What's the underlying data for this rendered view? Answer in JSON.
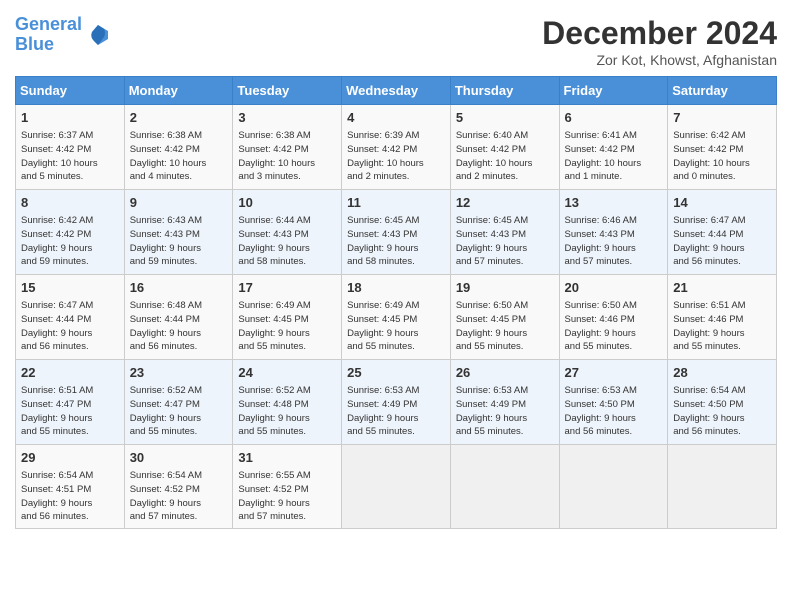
{
  "header": {
    "logo_line1": "General",
    "logo_line2": "Blue",
    "month": "December 2024",
    "location": "Zor Kot, Khowst, Afghanistan"
  },
  "days_of_week": [
    "Sunday",
    "Monday",
    "Tuesday",
    "Wednesday",
    "Thursday",
    "Friday",
    "Saturday"
  ],
  "weeks": [
    [
      {
        "day": "1",
        "sunrise": "6:37 AM",
        "sunset": "4:42 PM",
        "daylight": "10 hours and 5 minutes."
      },
      {
        "day": "2",
        "sunrise": "6:38 AM",
        "sunset": "4:42 PM",
        "daylight": "10 hours and 4 minutes."
      },
      {
        "day": "3",
        "sunrise": "6:38 AM",
        "sunset": "4:42 PM",
        "daylight": "10 hours and 3 minutes."
      },
      {
        "day": "4",
        "sunrise": "6:39 AM",
        "sunset": "4:42 PM",
        "daylight": "10 hours and 2 minutes."
      },
      {
        "day": "5",
        "sunrise": "6:40 AM",
        "sunset": "4:42 PM",
        "daylight": "10 hours and 2 minutes."
      },
      {
        "day": "6",
        "sunrise": "6:41 AM",
        "sunset": "4:42 PM",
        "daylight": "10 hours and 1 minute."
      },
      {
        "day": "7",
        "sunrise": "6:42 AM",
        "sunset": "4:42 PM",
        "daylight": "10 hours and 0 minutes."
      }
    ],
    [
      {
        "day": "8",
        "sunrise": "6:42 AM",
        "sunset": "4:42 PM",
        "daylight": "9 hours and 59 minutes."
      },
      {
        "day": "9",
        "sunrise": "6:43 AM",
        "sunset": "4:43 PM",
        "daylight": "9 hours and 59 minutes."
      },
      {
        "day": "10",
        "sunrise": "6:44 AM",
        "sunset": "4:43 PM",
        "daylight": "9 hours and 58 minutes."
      },
      {
        "day": "11",
        "sunrise": "6:45 AM",
        "sunset": "4:43 PM",
        "daylight": "9 hours and 58 minutes."
      },
      {
        "day": "12",
        "sunrise": "6:45 AM",
        "sunset": "4:43 PM",
        "daylight": "9 hours and 57 minutes."
      },
      {
        "day": "13",
        "sunrise": "6:46 AM",
        "sunset": "4:43 PM",
        "daylight": "9 hours and 57 minutes."
      },
      {
        "day": "14",
        "sunrise": "6:47 AM",
        "sunset": "4:44 PM",
        "daylight": "9 hours and 56 minutes."
      }
    ],
    [
      {
        "day": "15",
        "sunrise": "6:47 AM",
        "sunset": "4:44 PM",
        "daylight": "9 hours and 56 minutes."
      },
      {
        "day": "16",
        "sunrise": "6:48 AM",
        "sunset": "4:44 PM",
        "daylight": "9 hours and 56 minutes."
      },
      {
        "day": "17",
        "sunrise": "6:49 AM",
        "sunset": "4:45 PM",
        "daylight": "9 hours and 55 minutes."
      },
      {
        "day": "18",
        "sunrise": "6:49 AM",
        "sunset": "4:45 PM",
        "daylight": "9 hours and 55 minutes."
      },
      {
        "day": "19",
        "sunrise": "6:50 AM",
        "sunset": "4:45 PM",
        "daylight": "9 hours and 55 minutes."
      },
      {
        "day": "20",
        "sunrise": "6:50 AM",
        "sunset": "4:46 PM",
        "daylight": "9 hours and 55 minutes."
      },
      {
        "day": "21",
        "sunrise": "6:51 AM",
        "sunset": "4:46 PM",
        "daylight": "9 hours and 55 minutes."
      }
    ],
    [
      {
        "day": "22",
        "sunrise": "6:51 AM",
        "sunset": "4:47 PM",
        "daylight": "9 hours and 55 minutes."
      },
      {
        "day": "23",
        "sunrise": "6:52 AM",
        "sunset": "4:47 PM",
        "daylight": "9 hours and 55 minutes."
      },
      {
        "day": "24",
        "sunrise": "6:52 AM",
        "sunset": "4:48 PM",
        "daylight": "9 hours and 55 minutes."
      },
      {
        "day": "25",
        "sunrise": "6:53 AM",
        "sunset": "4:49 PM",
        "daylight": "9 hours and 55 minutes."
      },
      {
        "day": "26",
        "sunrise": "6:53 AM",
        "sunset": "4:49 PM",
        "daylight": "9 hours and 55 minutes."
      },
      {
        "day": "27",
        "sunrise": "6:53 AM",
        "sunset": "4:50 PM",
        "daylight": "9 hours and 56 minutes."
      },
      {
        "day": "28",
        "sunrise": "6:54 AM",
        "sunset": "4:50 PM",
        "daylight": "9 hours and 56 minutes."
      }
    ],
    [
      {
        "day": "29",
        "sunrise": "6:54 AM",
        "sunset": "4:51 PM",
        "daylight": "9 hours and 56 minutes."
      },
      {
        "day": "30",
        "sunrise": "6:54 AM",
        "sunset": "4:52 PM",
        "daylight": "9 hours and 57 minutes."
      },
      {
        "day": "31",
        "sunrise": "6:55 AM",
        "sunset": "4:52 PM",
        "daylight": "9 hours and 57 minutes."
      },
      null,
      null,
      null,
      null
    ]
  ]
}
